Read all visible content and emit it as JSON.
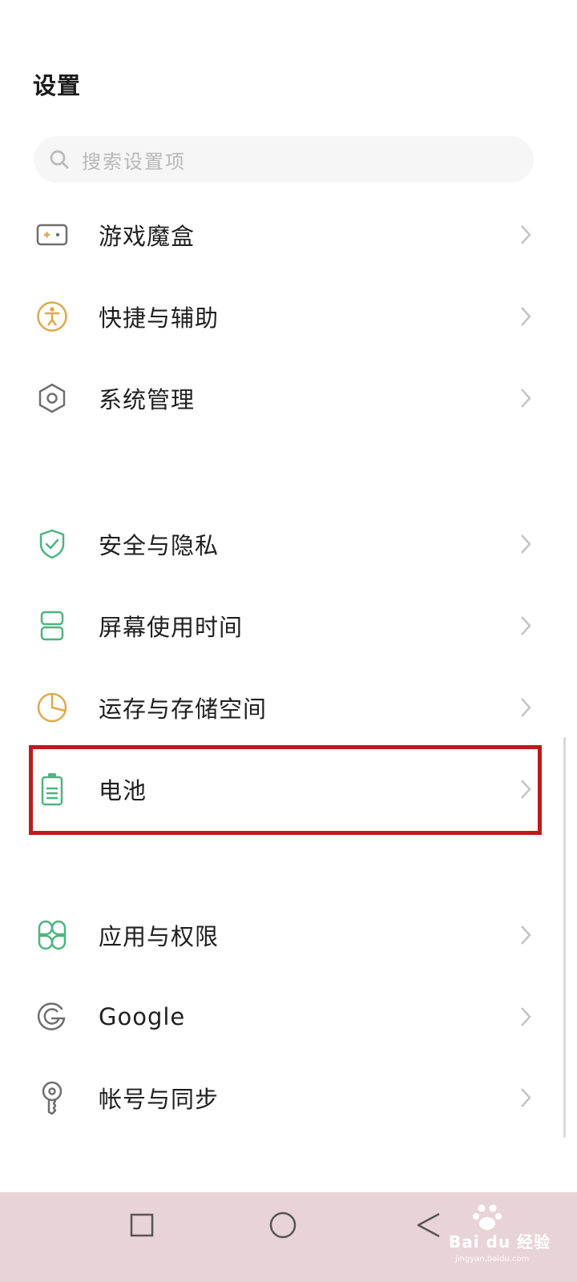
{
  "header": {
    "title": "设置"
  },
  "search": {
    "placeholder": "搜索设置项",
    "icon": "search-icon"
  },
  "settings": [
    {
      "label": "游戏魔盒",
      "icon": "gamepad-icon",
      "color": "#6f6f6f"
    },
    {
      "label": "快捷与辅助",
      "icon": "accessibility-icon",
      "color": "#e0a84a"
    },
    {
      "label": "系统管理",
      "icon": "hexagon-gear-icon",
      "color": "#6f6f6f"
    },
    {
      "label": "安全与隐私",
      "icon": "shield-check-icon",
      "color": "#4cb57f"
    },
    {
      "label": "屏幕使用时间",
      "icon": "hourglass-icon",
      "color": "#4cb57f"
    },
    {
      "label": "运存与存储空间",
      "icon": "pie-chart-icon",
      "color": "#e0a84a"
    },
    {
      "label": "电池",
      "icon": "battery-icon",
      "color": "#4cb57f",
      "highlighted": true
    },
    {
      "label": "应用与权限",
      "icon": "apps-grid-icon",
      "color": "#4cb57f"
    },
    {
      "label": "Google",
      "icon": "google-icon",
      "color": "#6f6f6f"
    },
    {
      "label": "帐号与同步",
      "icon": "key-icon",
      "color": "#6f6f6f"
    }
  ],
  "navbar": {
    "buttons": [
      "recents-button",
      "home-button",
      "back-button"
    ],
    "background": "#e8d3d9"
  },
  "watermark": {
    "text": "Bai du 经验",
    "sub": "jingyan.baidu.com"
  },
  "colors": {
    "accent_green": "#4cb57f",
    "accent_orange": "#e0a84a",
    "highlight": "#b91c1c"
  }
}
